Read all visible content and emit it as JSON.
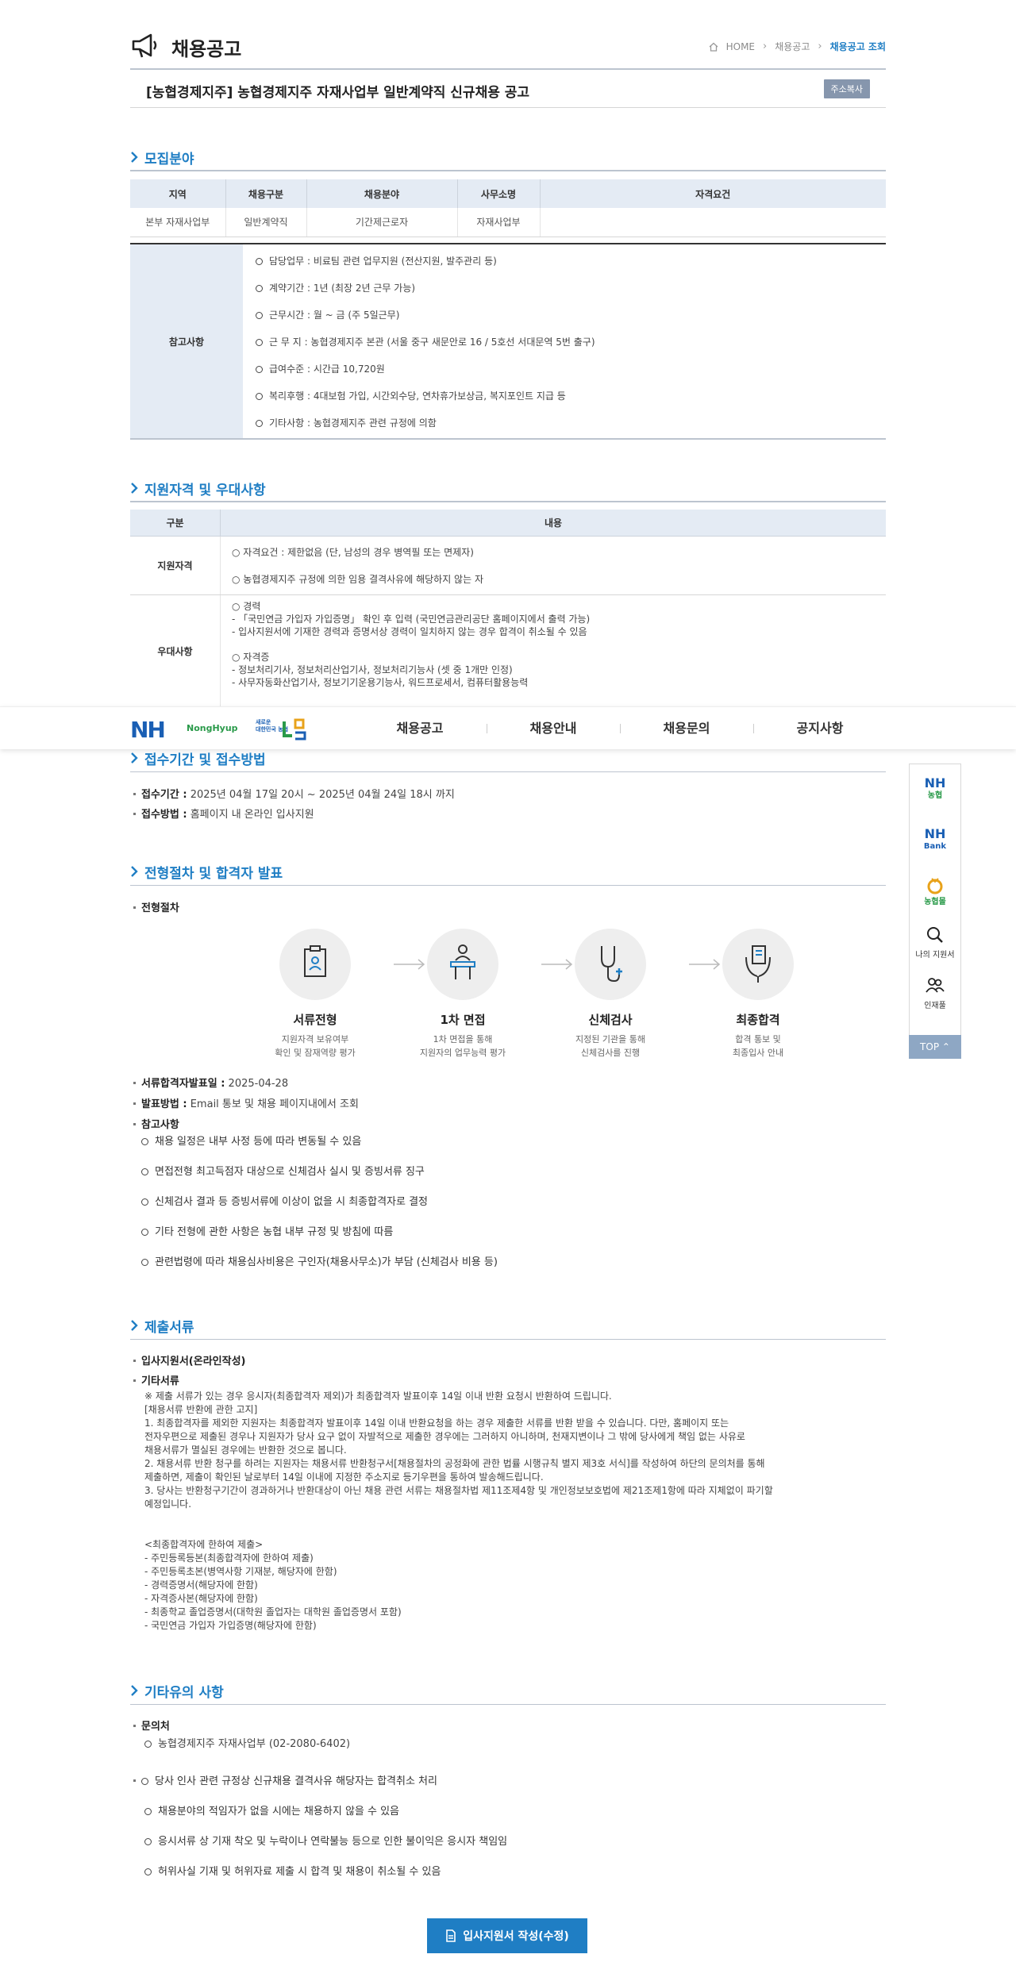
{
  "header": {
    "title": "채용공고",
    "breadcrumb": [
      "HOME",
      "채용공고",
      "채용공고 조회"
    ]
  },
  "notice": {
    "title": "[농협경제지주] 농협경제지주 자재사업부 일반계약직 신규채용 공고",
    "copy_label": "주소복사"
  },
  "recruit": {
    "heading": "모집분야",
    "columns": [
      "지역",
      "채용구분",
      "채용분야",
      "사무소명",
      "자격요건"
    ],
    "row": [
      "본부 자재사업부",
      "일반계약직",
      "기간제근로자",
      "자재사업부",
      ""
    ],
    "ref_label": "참고사항",
    "ref_items": [
      "담당업무 : 비료팀 관련 업무지원 (전산지원, 발주관리 등)",
      "계약기간 : 1년 (최장 2년 근무 가능)",
      "근무시간 : 월 ~ 금 (주 5일근무)",
      "근 무 지 : 농협경제지주 본관 (서울 중구 새문안로 16 / 5호선 서대문역 5번 출구)",
      "급여수준 : 시간급 10,720원",
      "복리후행 : 4대보험 가입, 시간외수당, 연차휴가보상금, 복지포인트 지급 등",
      "기타사항 : 농협경제지주 관련 규정에 의함"
    ]
  },
  "qualification": {
    "heading": "지원자격 및 우대사항",
    "col_type": "구분",
    "col_content": "내용",
    "rows": [
      {
        "label": "지원자격",
        "lines": [
          "○ 자격요건 : 제한없음 (단, 남성의 경우 병역필 또는 면제자)",
          "",
          "○ 농협경제지주 규정에 의한 임용 결격사유에 해당하지 않는 자"
        ]
      },
      {
        "label": "우대사항",
        "lines": [
          "○ 경력",
          "- 「국민연금 가입자 가입증명」 확인 후 입력 (국민연금관리공단 홈페이지에서 출력 가능)",
          "- 입사지원서에 기재한 경력과 증명서상 경력이 일치하지 않는 경우 합격이 취소될 수 있음",
          "",
          "○ 자격증",
          "- 정보처리기사, 정보처리산업기사, 정보처리기능사 (셋 중 1개만 인정)",
          "- 사무자동화산업기사, 정보기기운용기능사, 워드프로세서, 컴퓨터활용능력"
        ]
      }
    ]
  },
  "nav": {
    "logo": "NH",
    "logo_sub": "NongHyup",
    "gov_text": [
      "새로운",
      "대한민국 농협"
    ],
    "menu": [
      "채용공고",
      "채용안내",
      "채용문의",
      "공지사항"
    ]
  },
  "quick": {
    "items": [
      {
        "top": "NH",
        "bottom": "농협",
        "icon": "nh-nonghyup-logo"
      },
      {
        "top": "NH",
        "bottom": "Bank",
        "icon": "nh-bank-logo"
      },
      {
        "top": "",
        "bottom": "농협몰",
        "icon": "nh-mall-logo"
      },
      {
        "top": "",
        "bottom": "나의 지원서",
        "icon": "search-icon"
      },
      {
        "top": "",
        "bottom": "인재풀",
        "icon": "people-icon"
      }
    ],
    "top_label": "TOP"
  },
  "receipt": {
    "heading": "접수기간 및 접수방법",
    "period_label": "접수기간 :",
    "period_value": "2025년 04월 17일 20시 ~ 2025년 04월 24일 18시 까지",
    "method_label": "접수방법 :",
    "method_value": "홈페이지 내 온라인 입사지원"
  },
  "process": {
    "heading": "전형절차 및 합격자 발표",
    "sub": "전형절차",
    "steps": [
      {
        "name": "서류전형",
        "desc1": "지원자격 보유여부",
        "desc2": "확인 및 잠재역량 평가"
      },
      {
        "name": "1차 면접",
        "desc1": "1차 면접을 통해",
        "desc2": "지원자의 업무능력 평가"
      },
      {
        "name": "신체검사",
        "desc1": "지정된 기관을 통해",
        "desc2": "신체검사를 진행"
      },
      {
        "name": "최종합격",
        "desc1": "합격 통보 및",
        "desc2": "최종입사 안내"
      }
    ],
    "announce_label": "서류합격자발표일 :",
    "announce_value": "2025-04-28",
    "method_label": "발표방법 :",
    "method_value": "Email 통보 및 채용 페이지내에서 조회",
    "ref_label": "참고사항",
    "ref_items": [
      "채용 일정은 내부 사정 등에 따라 변동될 수 있음",
      "면접전형 최고득점자 대상으로 신체검사 실시 및 증빙서류 징구",
      "신체검사 결과 등 증빙서류에 이상이 없을 시 최종합격자로 결정",
      "기타 전형에 관한 사항은 농협 내부 규정 및 방침에 따름",
      "관련법령에 따라 채용심사비용은 구인자(채용사무소)가 부담 (신체검사 비용 등)"
    ]
  },
  "documents": {
    "heading": "제출서류",
    "item1": "입사지원서(온라인작성)",
    "item2": "기타서류",
    "paragraph": [
      "※ 제출 서류가 있는 경우 응시자(최종합격자 제외)가 최종합격자 발표이후 14일 이내 반환 요청시 반환하여 드립니다.",
      "[채용서류 반환에 관한 고지]",
      " 1. 최종합격자를 제외한 지원자는 최종합격자 발표이후 14일 이내 반환요청을 하는 경우 제출한 서류를 반환 받을 수 있습니다. 다만, 홈페이지 또는",
      "전자우편으로 제출된 경우나 지원자가 당사 요구 없이 자발적으로 제출한 경우에는 그러하지 아니하며, 천재지변이나 그 밖에 당사에게 책임 없는 사유로",
      "채용서류가 멸실된 경우에는 반환한 것으로 봅니다.",
      " 2. 채용서류 반환 청구를 하려는 지원자는 채용서류 반환청구서[채용절차의 공정화에 관한 법률 시행규칙 별지 제3호 서식]를 작성하여 하단의 문의처를 통해",
      "제출하면, 제출이 확인된 날로부터 14일 이내에 지정한 주소지로 등기우편을 통하여 발송해드립니다.",
      " 3. 당사는 반환청구기간이 경과하거나 반환대상이 아닌 채용 관련 서류는 채용절차법 제11조제4항 및 개인정보보호법에 제21조제1항에 따라 지체없이 파기할",
      "예정입니다.",
      "",
      "",
      "<최종합격자에 한하여 제출>",
      "- 주민등록등본(최종합격자에 한하여 제출)",
      "- 주민등록초본(병역사항 기재분, 해당자에 한함)",
      "- 경력증명서(해당자에 한함)",
      "- 자격증사본(해당자에 한함)",
      "- 최종학교 졸업증명서(대학원 졸업자는 대학원 졸업증명서 포함)",
      "- 국민연금 가입자 가입증명(해당자에 한함)"
    ]
  },
  "etc": {
    "heading": "기타유의 사항",
    "contact_label": "문의처",
    "contact_value": "농협경제지주 자재사업부 (02-2080-6402)",
    "items": [
      "당사 인사 관련 규정상 신규채용 결격사유 해당자는 합격취소 처리",
      "채용분야의 적임자가 없을 시에는 채용하지 않을 수 있음",
      "응시서류 상 기재 착오 및 누락이나 연락불능 등으로 인한 불이익은 응시자 책임임",
      "허위사실 기재 및 허위자료 제출 시 합격 및 채용이 취소될 수 있음"
    ]
  },
  "submit_label": "입사지원서 작성(수정)",
  "colors": {
    "accent": "#1f7ec4",
    "header_bg": "#e4ebf4",
    "top_btn": "#8ea7c4",
    "logo_blue": "#1a5fb4",
    "logo_green": "#2a9a4a"
  }
}
